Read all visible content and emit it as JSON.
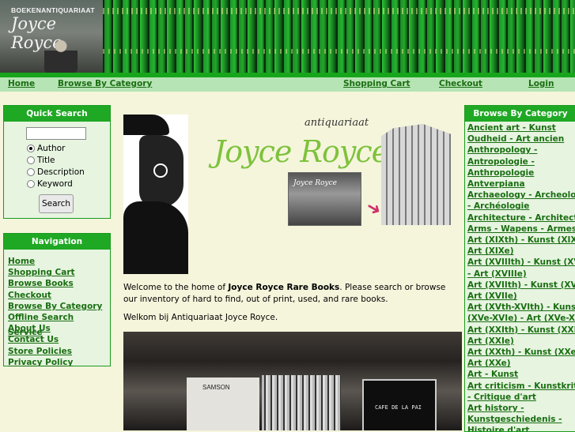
{
  "header": {
    "logo_top": "BOEKENANTIQUARIAAT",
    "logo_script": "Joyce Royce"
  },
  "topnav": {
    "home": "Home",
    "browse": "Browse By Category",
    "cart": "Shopping Cart",
    "checkout": "Checkout",
    "login": "Login"
  },
  "quick_search": {
    "title": "Quick Search",
    "input_value": "",
    "options": [
      "Author",
      "Title",
      "Description",
      "Keyword"
    ],
    "selected": "Author",
    "button": "Search"
  },
  "navigation": {
    "title": "Navigation",
    "items": [
      "Home",
      "Shopping Cart",
      "Browse Books",
      "Checkout",
      "Browse By Category",
      "Offline Search Service",
      "About Us",
      "Contact Us",
      "Store Policies",
      "Privacy Policy"
    ]
  },
  "hero": {
    "antiquariaat": "antiquariaat",
    "logo": "Joyce Royce",
    "shop_sign": "Joyce Royce"
  },
  "main": {
    "welcome_prefix": "Welcome to the home of ",
    "welcome_bold": "Joyce Royce Rare Books",
    "welcome_suffix": ". Please search or browse our inventory of hard to find, out of print, used, and rare books.",
    "welcome_nl": "Welkom bij Antiquariaat Joyce Royce.",
    "photo_sign": "SAMSON",
    "photo_cafe": "CAFE DE LA PAI"
  },
  "categories": {
    "title": "Browse By Category",
    "items": [
      "Ancient art - Kunst",
      "Oudheid - Art ancien",
      "Anthropology -",
      "Antropologie -",
      "Anthropologie",
      "Antverpiana",
      "Archaeology - Archeologie",
      "- Archéologie",
      "Architecture - Architectuur",
      "Arms - Wapens - Armes",
      "Art (XIXth) - Kunst (XIXe) -",
      "Art (XIXe)",
      "Art (XVIIIth) - Kunst (XVIIIe)",
      "- Art (XVIIIe)",
      "Art (XVIIth) - Kunst (XVIIe) -",
      "Art (XVIIe)",
      "Art (XVth-XVIth) - Kunst",
      "(XVe-XVIe) - Art (XVe-XVIe)",
      "Art (XXIth) - Kunst (XXIe) -",
      "Art (XXIe)",
      "Art (XXth) - Kunst (XXe) -",
      "Art (XXe)",
      "Art - Kunst",
      "Art criticism - Kunstkritiek",
      "- Critique d'art",
      "Art history -",
      "Kunstgeschiedenis -",
      "Histoire d'art"
    ]
  }
}
